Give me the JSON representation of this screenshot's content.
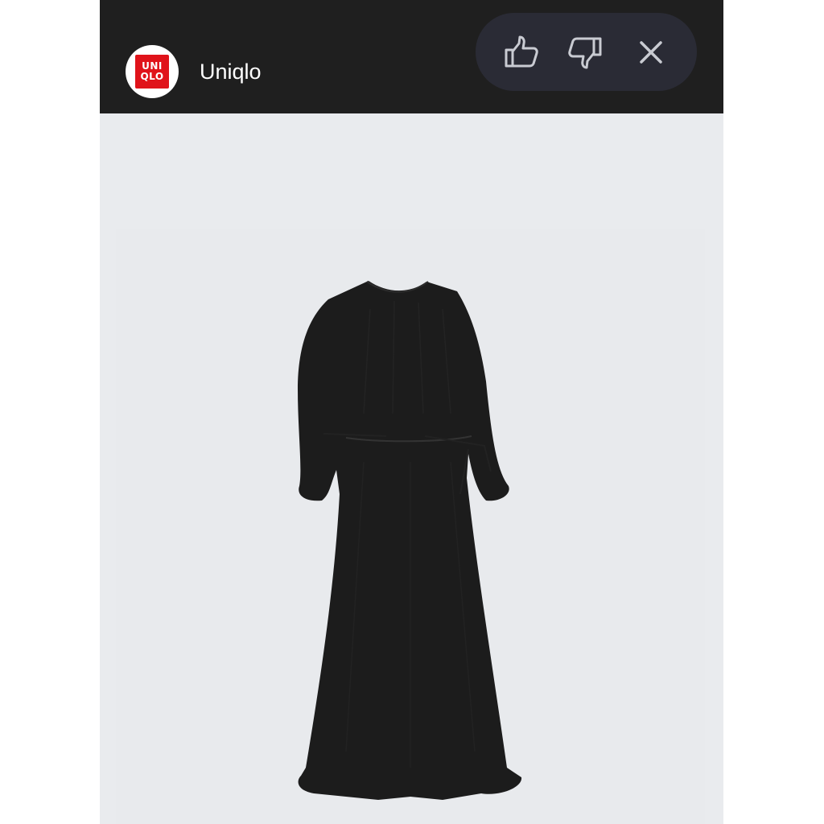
{
  "app": {
    "brand_name": "Uniqlo",
    "logo": {
      "line1": "UNI",
      "line2": "QLO",
      "color": "#e0131a"
    }
  },
  "feedback_bar": {
    "like_icon": "thumbs-up-icon",
    "dislike_icon": "thumbs-down-icon",
    "close_icon": "close-icon"
  },
  "product": {
    "image": "black-long-sleeve-gathered-dress",
    "color": "#1c1c1c",
    "background": "#e9ebee"
  },
  "colors": {
    "header_bg": "#1f1f1f",
    "feedback_bg": "#2a2b35",
    "icon_stroke": "#c9cbd2"
  }
}
